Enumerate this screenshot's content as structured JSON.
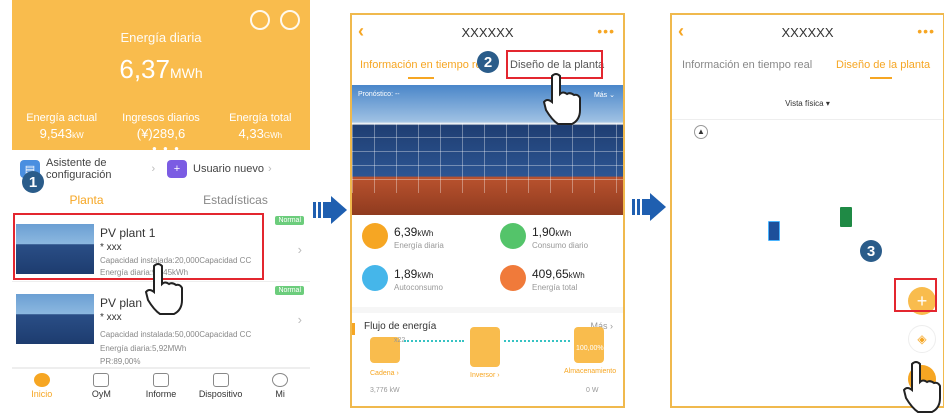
{
  "screen1": {
    "hero": {
      "title": "Energía diaria",
      "value": "6,37",
      "unit": "MWh",
      "stats": [
        {
          "label": "Energía actual",
          "value": "9,543",
          "unit": "kW"
        },
        {
          "label": "Ingresos diarios",
          "value": "(¥)289,6",
          "unit": ""
        },
        {
          "label": "Energía total",
          "value": "4,33",
          "unit": "GWh"
        }
      ]
    },
    "quick": {
      "assistant_line1": "Asistente de",
      "assistant_line2": "configuración",
      "new_user": "Usuario nuevo"
    },
    "tabs": [
      "Planta",
      "Estadísticas"
    ],
    "plants": [
      {
        "name": "PV plant 1",
        "sub": "* xxx",
        "line1": "Capacidad instalada:20,000Capacidad CC",
        "line2": "Energía diaria:97,45kWh",
        "line3": "",
        "badge": "Normal"
      },
      {
        "name": "PV plan",
        "sub": "* xxx",
        "line1": "Capacidad instalada:50,000Capacidad CC",
        "line2": "Energía diaria:5,92MWh",
        "line3": "PR:89,00%",
        "badge": "Normal"
      }
    ],
    "nav": [
      "Inicio",
      "OyM",
      "Informe",
      "Dispositivo",
      "Mi"
    ],
    "step": "1"
  },
  "screen2": {
    "title": "XXXXXX",
    "tab_realtime": "Información en tiempo re",
    "tab_design": "Diseño de la planta",
    "forecast": "Pronóstico: --",
    "more": "Más",
    "kpis": [
      {
        "value": "6,39",
        "unit": "kWh",
        "label": "Energía diaria",
        "color": "#f6a623"
      },
      {
        "value": "1,90",
        "unit": "kWh",
        "label": "Consumo diario",
        "color": "#54c46a"
      },
      {
        "value": "1,89",
        "unit": "kWh",
        "label": "Autoconsumo",
        "color": "#45b6ea"
      },
      {
        "value": "409,65",
        "unit": "kWh",
        "label": "Energía total",
        "color": "#f07a3a"
      }
    ],
    "flow": {
      "title": "Flujo de energía",
      "more": "Más",
      "count": "x22",
      "node1": "Cadena",
      "node2": "Inversor",
      "node3": "Almacenamiento",
      "soc": "100,00%",
      "val1": "3,776 kW",
      "val3": "0 W"
    },
    "step": "2"
  },
  "screen3": {
    "title": "XXXXXX",
    "tab_realtime": "Información en tiempo real",
    "tab_design": "Diseño de la planta",
    "view": "Vista física",
    "fab_add": "+",
    "step": "3"
  }
}
